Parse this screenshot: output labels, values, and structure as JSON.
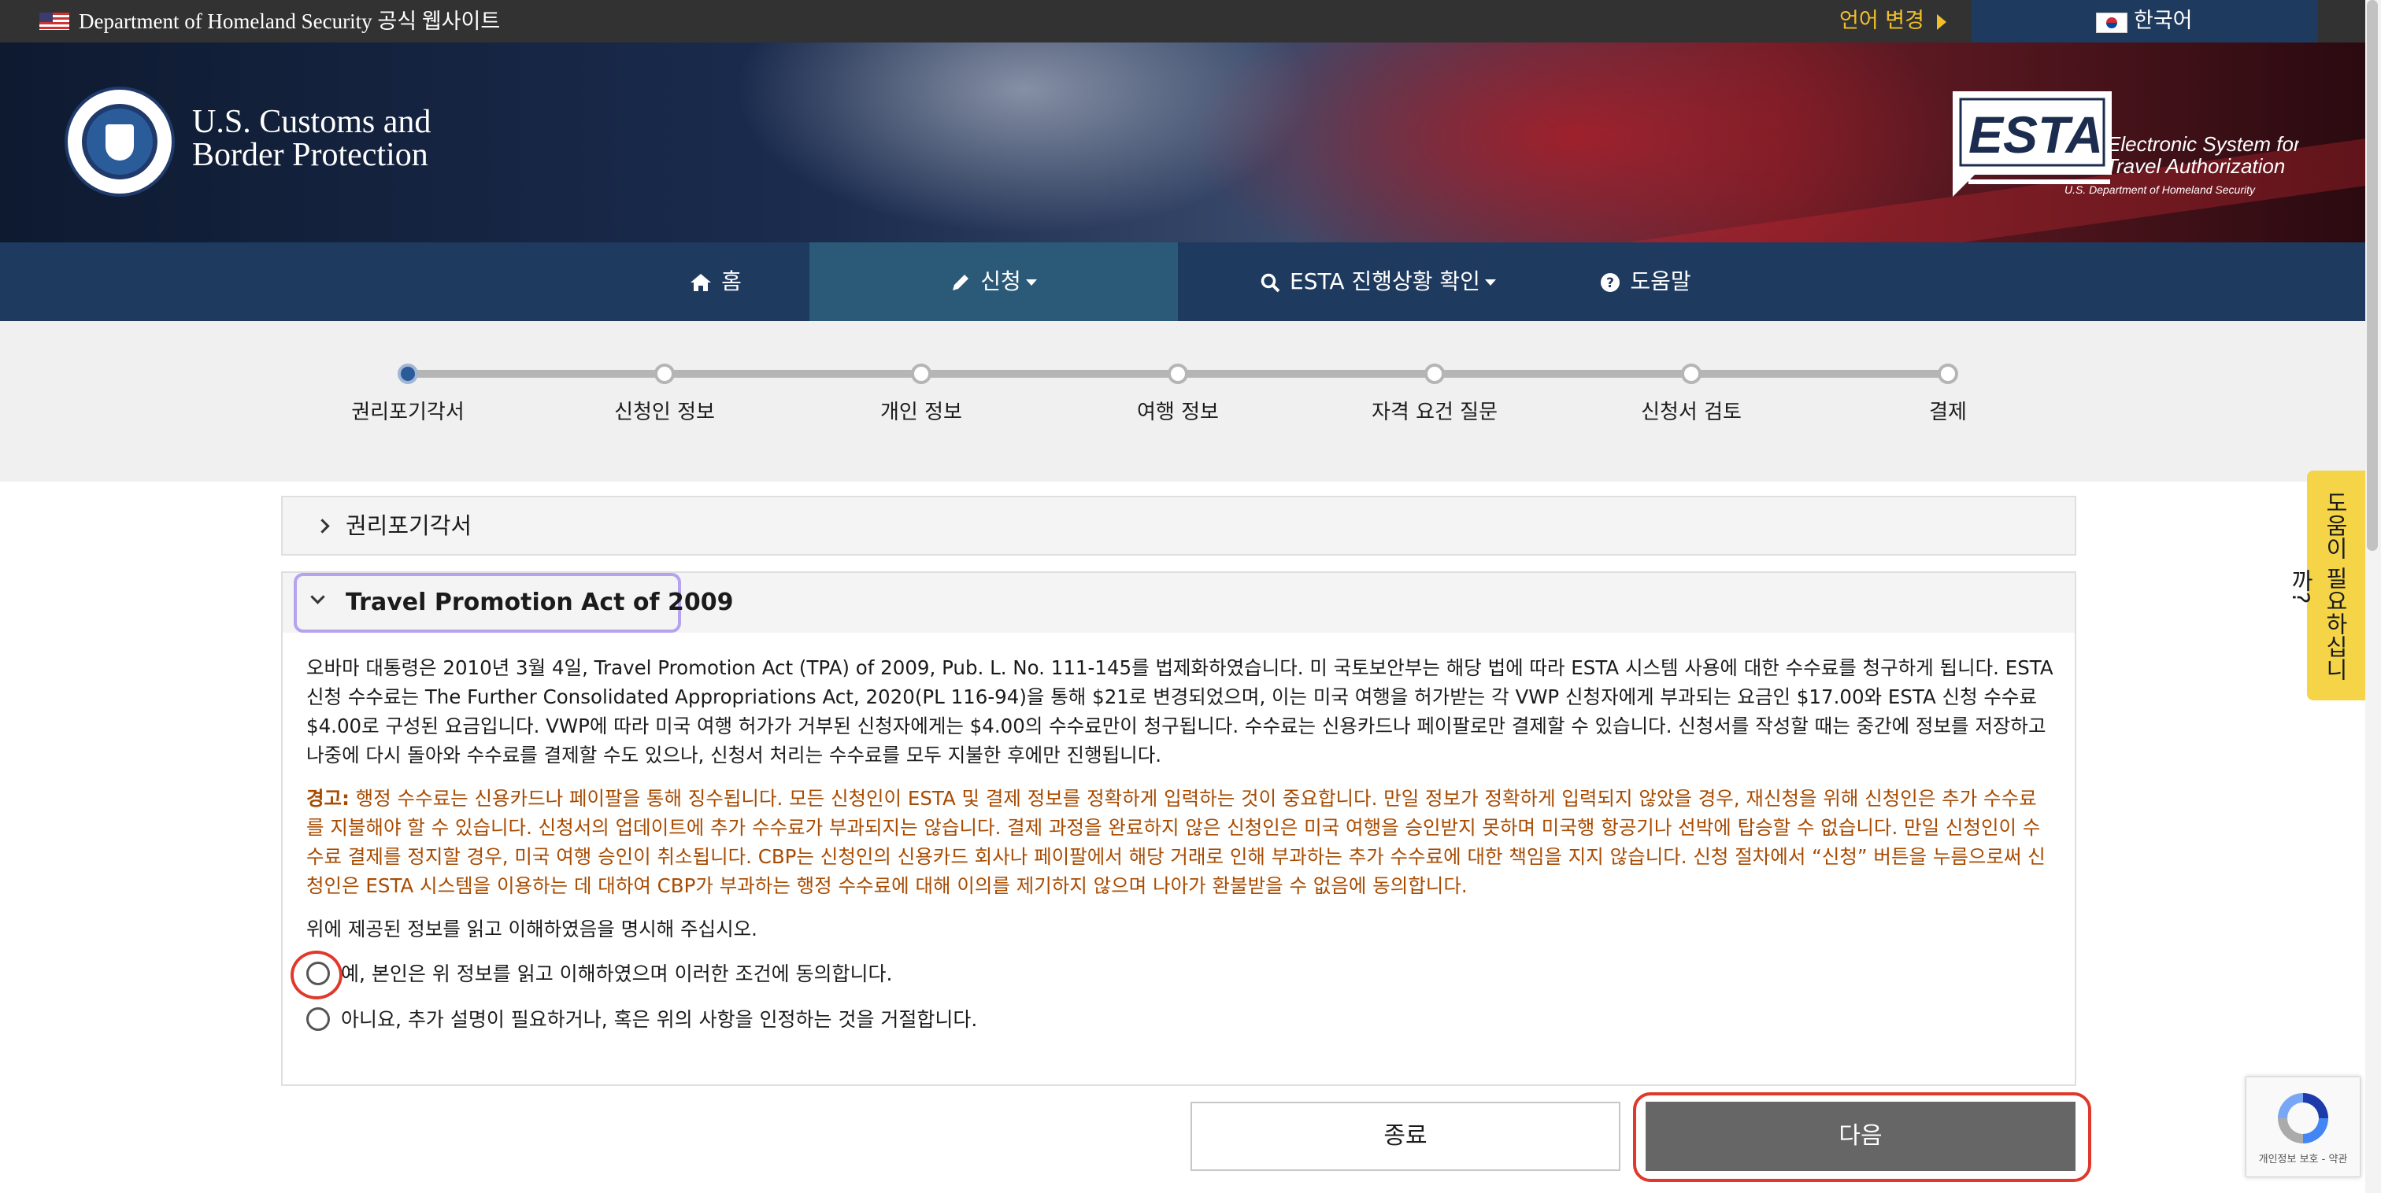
{
  "topbar": {
    "gov_text": "Department of Homeland Security 공식 웹사이트",
    "language_change": "언어 변경",
    "current_language": "한국어"
  },
  "header": {
    "agency_title": "U.S. Customs and Border Protection",
    "esta_mark": "ESTA",
    "esta_tagline_1": "Electronic System for",
    "esta_tagline_2": "Travel Authorization",
    "esta_dept": "U.S. Department of Homeland Security"
  },
  "nav": {
    "home": "홈",
    "apply": "신청",
    "status": "ESTA 진행상황 확인",
    "help": "도움말"
  },
  "progress": {
    "current_step": 0,
    "steps": [
      "권리포기각서",
      "신청인 정보",
      "개인 정보",
      "여행 정보",
      "자격 요건 질문",
      "신청서 검토",
      "결제"
    ]
  },
  "accordion": {
    "waiver_title": "권리포기각서",
    "tpa_title": "Travel Promotion Act of 2009"
  },
  "tpa": {
    "intro": "오바마 대통령은 2010년 3월 4일, Travel Promotion Act (TPA) of 2009, Pub. L. No. 111-145를 법제화하였습니다. 미 국토보안부는 해당 법에 따라 ESTA 시스템 사용에 대한 수수료를 청구하게 됩니다. ESTA 신청 수수료는 The Further Consolidated Appropriations Act, 2020(PL 116-94)을 통해 $21로 변경되었으며, 이는 미국 여행을 허가받는 각 VWP 신청자에게 부과되는 요금인 $17.00와 ESTA 신청 수수료 $4.00로 구성된 요금입니다. VWP에 따라 미국 여행 허가가 거부된 신청자에게는 $4.00의 수수료만이 청구됩니다. 수수료는 신용카드나 페이팔로만 결제할 수 있습니다. 신청서를 작성할 때는 중간에 정보를 저장하고 나중에 다시 돌아와 수수료를 결제할 수도 있으나, 신청서 처리는 수수료를 모두 지불한 후에만 진행됩니다.",
    "warning_label": "경고:",
    "warning_text": " 행정 수수료는 신용카드나 페이팔을 통해 징수됩니다. 모든 신청인이 ESTA 및 결제 정보를 정확하게 입력하는 것이 중요합니다. 만일 정보가 정확하게 입력되지 않았을 경우, 재신청을 위해 신청인은 추가 수수료를 지불해야 할 수 있습니다. 신청서의 업데이트에 추가 수수료가 부과되지는 않습니다. 결제 과정을 완료하지 않은 신청인은 미국 여행을 승인받지 못하며 미국행 항공기나 선박에 탑승할 수 없습니다. 만일 신청인이 수수료 결제를 정지할 경우, 미국 여행 승인이 취소됩니다. CBP는 신청인의 신용카드 회사나 페이팔에서 해당 거래로 인해 부과하는 추가 수수료에 대한 책임을 지지 않습니다. 신청 절차에서 “신청” 버튼을 누름으로써 신청인은 ESTA 시스템을 이용하는 데 대하여 CBP가 부과하는 행정 수수료에 대해 이의를 제기하지 않으며 나아가 환불받을 수 없음에 동의합니다.",
    "instruction": "위에 제공된 정보를 읽고 이해하였음을 명시해 주십시오.",
    "option_yes": "예, 본인은 위 정보를 읽고 이해하였으며 이러한 조건에 동의합니다.",
    "option_no": "아니요, 추가 설명이 필요하거나, 혹은 위의 사항을 인정하는 것을 거절합니다.",
    "selected": null
  },
  "buttons": {
    "exit": "종료",
    "next": "다음"
  },
  "help_tab": "도움이 필요하십니까?",
  "recaptcha": {
    "privacy": "개인정보 보호 - 약관"
  },
  "colors": {
    "nav_bg": "#1f3a5f",
    "nav_active": "#2b5a78",
    "warning": "#a84b00",
    "next_button": "#666666",
    "highlight": "#e0392b",
    "help_tab": "#f5d547"
  }
}
